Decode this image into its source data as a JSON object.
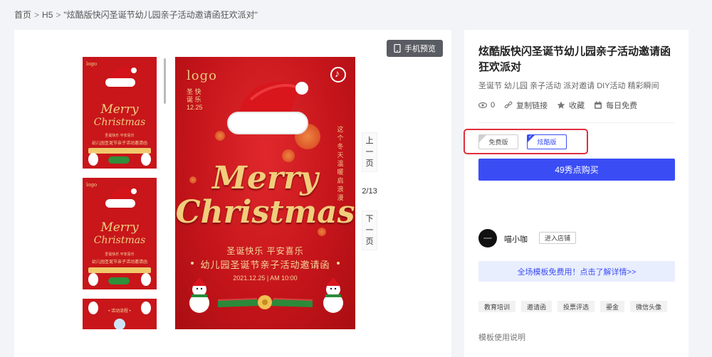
{
  "breadcrumb": {
    "home": "首页",
    "sep": ">",
    "h5": "H5",
    "current": "\"炫酷版快闪圣诞节幼儿园亲子活动邀请函狂欢派对\""
  },
  "preview": {
    "mobile_preview_label": "手机预览",
    "page_counter": "2/13",
    "prev_page": [
      "上",
      "一",
      "页"
    ],
    "next_page": [
      "下",
      "一",
      "页"
    ],
    "poster": {
      "logo_text": "logo",
      "vertical_greeting": [
        "圣 快",
        "诞 乐",
        "12.25"
      ],
      "side_text": "这个冬天温暖启浪漫",
      "merry": "Merry",
      "christmas": "Christmas",
      "line1": "圣诞快乐 平安喜乐",
      "line2": "幼儿园圣诞节亲子活动邀请函",
      "date": "2021.12.25 | AM 10:00"
    },
    "thumbnails": [
      {
        "logo": "logo",
        "merry": "Merry",
        "christmas": "Christmas",
        "line1": "圣诞快乐 平安喜乐",
        "line2": "幼儿园圣诞节亲子活动邀请函"
      },
      {
        "logo": "logo",
        "merry": "Merry",
        "christmas": "Christmas",
        "line1": "圣诞快乐 平安喜乐",
        "line2": "幼儿园圣诞节亲子活动邀请函"
      },
      {
        "line1": "• 活动流程 •"
      }
    ]
  },
  "detail": {
    "title": "炫酷版快闪圣诞节幼儿园亲子活动邀请函狂欢派对",
    "keywords": "圣诞节 幼儿园 亲子活动 派对邀请 DIY活动 精彩瞬间",
    "stats": {
      "views": "0",
      "copy_link": "复制链接",
      "favorite": "收藏",
      "daily_free": "每日免费"
    },
    "versions": [
      {
        "label": "免费版",
        "active": false
      },
      {
        "label": "炫酷版",
        "active": true
      }
    ],
    "buy_label": "49秀点购买",
    "shop": {
      "name": "喵小咖",
      "enter_label": "进入店铺"
    },
    "promo": "全场模板免费用！点击了解详情>>",
    "tags": [
      "教育培训",
      "邀请函",
      "投票评选",
      "鎏金",
      "微信头像"
    ],
    "usage": "模板使用说明"
  },
  "colors": {
    "accent_blue": "#3a4df5",
    "highlight_red": "#e02e3e",
    "poster_red": "#c8161a",
    "gold": "#f1cd7c"
  }
}
